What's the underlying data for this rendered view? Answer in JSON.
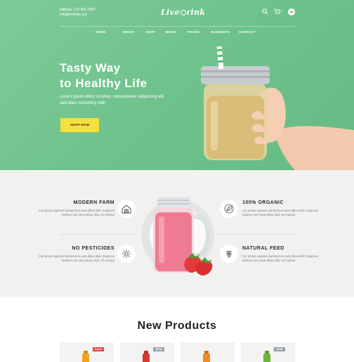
{
  "header": {
    "contact_label": "Call us:",
    "phone": "123-456-7890",
    "email": "info@website.org",
    "logo_text_a": "Live",
    "logo_text_b": "rink",
    "cart_count": "0",
    "language": "en"
  },
  "nav": {
    "items": [
      "HOME",
      "ABOUT",
      "SHOP",
      "NEWS",
      "PAGES",
      "ELEMENTS",
      "CONTACT"
    ]
  },
  "hero": {
    "title_line1": "Tasty Way",
    "title_line2": "to Healthy Life",
    "subtitle": "Lorem ipsum dolor sit amet, consectetuer adipiscing elit, sed diam nonummy nibh",
    "button": "SHOP NOW"
  },
  "features": [
    {
      "title": "MODERN FARM",
      "text": "Cur tantas regiones barbarorum peat dibus obiit, tregiones barbaro num peat dibus obiit, tot mariata",
      "icon": "barn-icon"
    },
    {
      "title": "100% ORGANIC",
      "text": "Cur tantas regiones barbarorum peat dibus obiit, tregiones barbaro num peat dibus obiit, tot mariata",
      "icon": "organic-leaf-icon"
    },
    {
      "title": "NO PESTICIDES",
      "text": "Cur tantas regiones barbarorum peat dibus obiit, tregiones barbaro num peat dibus obiit, tot mariata",
      "icon": "flower-icon"
    },
    {
      "title": "NATURAL FEED",
      "text": "Cur tantas regiones barbarorum peat dibus obiit, tregiones barbaro num peat dibus obiit, tot mariata",
      "icon": "wheat-icon"
    }
  ],
  "products": {
    "title": "New Products",
    "cards": [
      {
        "badge": "SALE",
        "badge_color": "#e4474a",
        "bottle_color": "#f0a21f"
      },
      {
        "badge": "NEW",
        "badge_color": "#9aa2a8",
        "bottle_color": "#d9382f"
      },
      {
        "badge": "",
        "badge_color": "",
        "bottle_color": "#ef8a22"
      },
      {
        "badge": "NEW",
        "badge_color": "#9aa2a8",
        "bottle_color": "#6cb533"
      }
    ]
  },
  "colors": {
    "hero_green": "#6cc08a",
    "button_yellow": "#f5e13b",
    "features_bg": "#f1f1f0",
    "smoothie_pink": "#ee7b91"
  }
}
